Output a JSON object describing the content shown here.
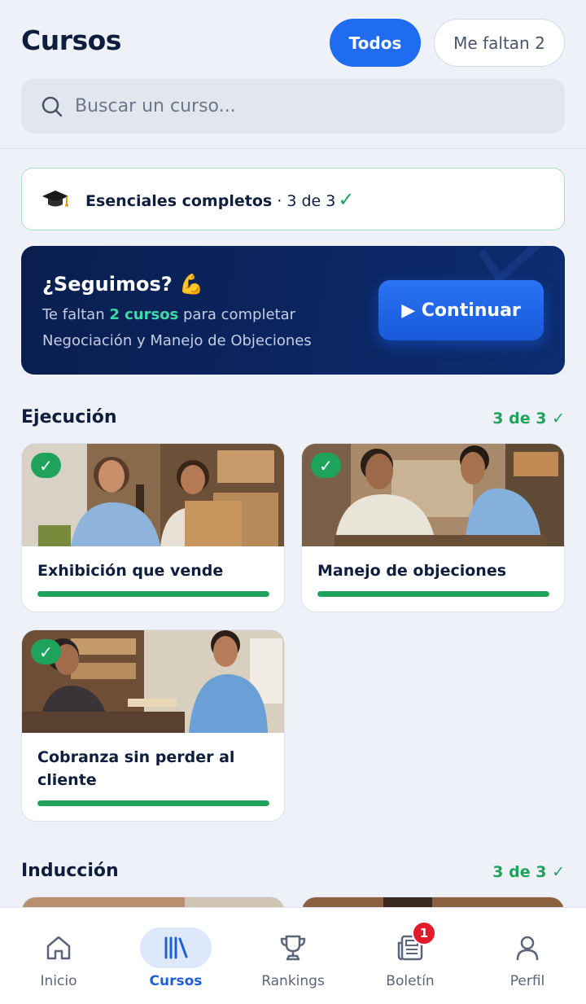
{
  "header": {
    "title": "Cursos",
    "filters": [
      {
        "label": "Todos",
        "active": true
      },
      {
        "label": "Me faltan 2",
        "active": false
      }
    ],
    "search_placeholder": "Buscar un curso..."
  },
  "banner": {
    "icon": "graduation-cap-icon",
    "title": "Esenciales completos",
    "count": "· 3 de 3",
    "check": "✓"
  },
  "promo": {
    "title": "¿Seguimos? 💪",
    "line1_prefix": "Te faltan ",
    "line1_highlight": "2 cursos",
    "line1_suffix": " para completar",
    "line2": "Negociación y Manejo de Objeciones",
    "button_label": "▶ Continuar"
  },
  "sections": [
    {
      "title": "Ejecución",
      "count": "3 de 3 ✓",
      "courses": [
        {
          "title": "Exhibición que vende",
          "progress": 1.0,
          "completed": true
        },
        {
          "title": "Manejo de objeciones",
          "progress": 1.0,
          "completed": true
        },
        {
          "title": "Cobranza sin perder al cliente",
          "progress": 1.0,
          "completed": true
        }
      ]
    },
    {
      "title": "Inducción",
      "count": "3 de 3 ✓",
      "courses": []
    }
  ],
  "check_mark": "✓",
  "bottom_nav": [
    {
      "label": "Inicio",
      "icon": "home-icon",
      "active": false
    },
    {
      "label": "Cursos",
      "icon": "library-icon",
      "active": true
    },
    {
      "label": "Rankings",
      "icon": "trophy-icon",
      "active": false
    },
    {
      "label": "Boletín",
      "icon": "newspaper-icon",
      "active": false,
      "badge": "1"
    },
    {
      "label": "Perfil",
      "icon": "user-icon",
      "active": false
    }
  ],
  "colors": {
    "accent": "#1f6cf0",
    "success": "#1fa35c",
    "navy": "#0b2663",
    "badge": "#e21b2a"
  }
}
